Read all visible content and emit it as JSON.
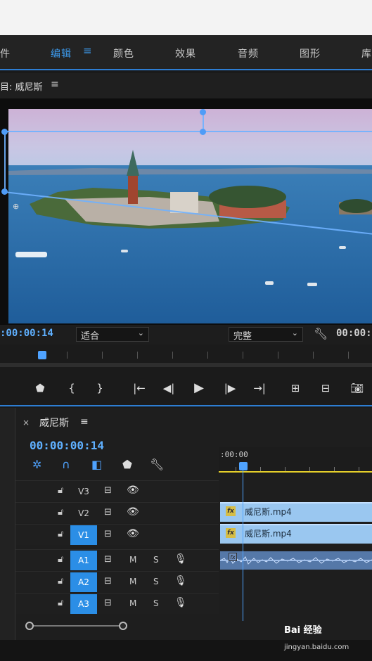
{
  "menu": {
    "items": [
      "件",
      "编辑",
      "颜色",
      "效果",
      "音频",
      "图形",
      "库"
    ],
    "active_index": 1
  },
  "program": {
    "title": "目: 威尼斯",
    "menu_icon": "≡"
  },
  "viewer": {
    "timecode": ":00:00:14",
    "fit_value": "适合",
    "quality_value": "完整",
    "right_timecode": "00:00:"
  },
  "transport": {
    "icons": [
      "marker-icon",
      "mark-in-icon",
      "mark-out-icon",
      "go-to-in-icon",
      "step-back-icon",
      "play-icon",
      "step-forward-icon",
      "go-to-out-icon",
      "insert-icon",
      "overwrite-icon",
      "camera-icon"
    ]
  },
  "sequence": {
    "close": "×",
    "name": "威尼斯",
    "menu_icon": "≡",
    "timecode": "00:00:00:14",
    "ruler_timecode": ":00:00"
  },
  "tracks": {
    "video": [
      {
        "label": "V3",
        "active": false
      },
      {
        "label": "V2",
        "active": false
      },
      {
        "label": "V1",
        "active": true
      }
    ],
    "audio": [
      {
        "label": "A1",
        "active": true,
        "m": "M",
        "s": "S"
      },
      {
        "label": "A2",
        "active": true,
        "m": "M",
        "s": "S"
      },
      {
        "label": "A3",
        "active": true,
        "m": "M",
        "s": "S"
      }
    ]
  },
  "clips": {
    "v2": "威尼斯.mp4",
    "v1": "威尼斯.mp4",
    "fx": "fx"
  },
  "watermark": {
    "main": "Bai 经验",
    "sub": "jingyan.baidu.com"
  },
  "colors": {
    "accent": "#2d7dd2",
    "timecode": "#5fb0ff",
    "clip": "#9ac7f0",
    "audio_clip": "#5578a8",
    "work_area": "#e5cf2a"
  }
}
